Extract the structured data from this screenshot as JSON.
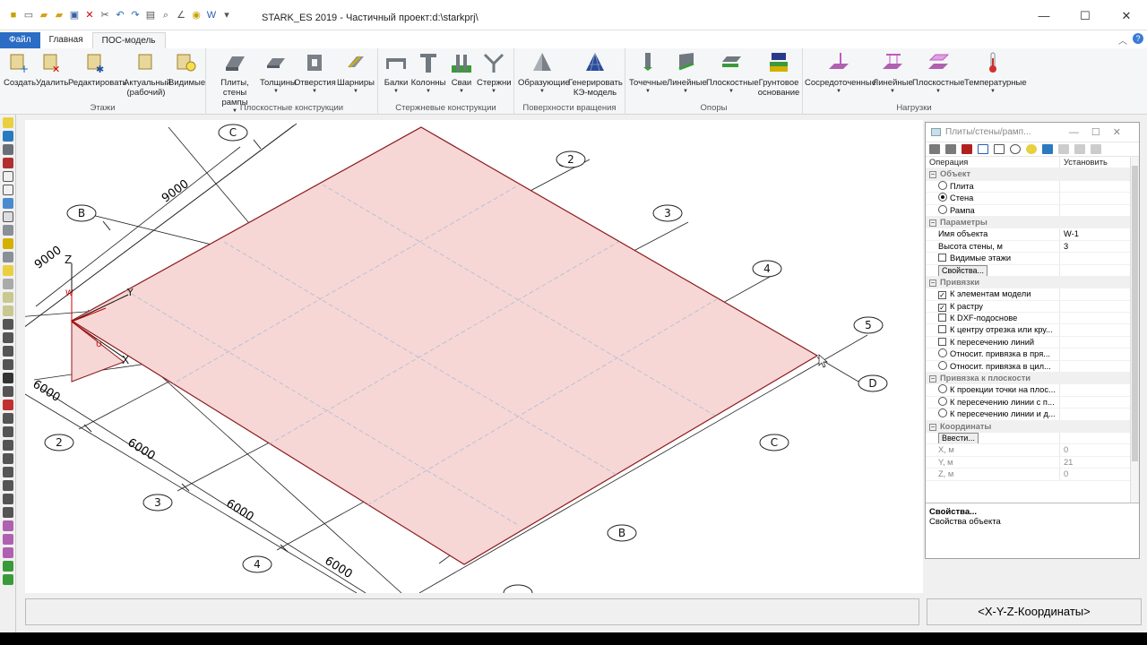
{
  "window": {
    "title": "STARK_ES 2019 - Частичный проект:d:\\starkprj\\",
    "minimize": "—",
    "maximize": "☐",
    "close": "✕"
  },
  "tabs": [
    {
      "label": "Файл"
    },
    {
      "label": "Главная"
    },
    {
      "label": "ПОС-модель"
    }
  ],
  "ribbon": {
    "groups": [
      {
        "name": "Этажи",
        "buttons": [
          "Создать",
          "Удалить",
          "Редактировать",
          "Актуальный (рабочий)",
          "Видимые"
        ]
      },
      {
        "name": "Плоскостные конструкции",
        "buttons": [
          "Плиты, стены рампы",
          "Толщины",
          "Отверстия",
          "Шарниры"
        ]
      },
      {
        "name": "Стержневые конструкции",
        "buttons": [
          "Балки",
          "Колонны",
          "Сваи",
          "Стержни"
        ]
      },
      {
        "name": "Поверхности вращения",
        "buttons": [
          "Образующие",
          "Генерировать КЭ-модель"
        ]
      },
      {
        "name": "Опоры",
        "buttons": [
          "Точечные",
          "Линейные",
          "Плоскостные",
          "Грунтовое основание"
        ]
      },
      {
        "name": "Нагрузки",
        "buttons": [
          "Сосредоточенные",
          "Линейные",
          "Плоскостные",
          "Температурные"
        ]
      }
    ]
  },
  "viewport": {
    "axis_labels": {
      "z": "Z",
      "y": "Y",
      "x": "X",
      "w": "W",
      "u": "U"
    },
    "grid_circles": [
      "C",
      "B",
      "2",
      "3",
      "4",
      "5",
      "D",
      "C",
      "B",
      "2",
      "3",
      "4"
    ],
    "dimensions": [
      "9000",
      "9000",
      "6000",
      "6000",
      "6000",
      "6000"
    ]
  },
  "panel": {
    "title": "Плиты/стены/рамп...",
    "header": {
      "col1": "Операция",
      "col2": "Установить"
    },
    "sections": {
      "object": "Объект",
      "params": "Параметры",
      "snaps": "Привязки",
      "plane_snap": "Привязка к плоскости",
      "coords": "Координаты"
    },
    "object_options": [
      {
        "label": "Плита",
        "selected": false
      },
      {
        "label": "Стена",
        "selected": true
      },
      {
        "label": "Рампа",
        "selected": false
      }
    ],
    "params": {
      "name_label": "Имя объекта",
      "name_value": "W-1",
      "height_label": "Высота стены, м",
      "height_value": "3",
      "visible_floors": "Видимые этажи",
      "props_button": "Свойства..."
    },
    "snaps": [
      {
        "label": "К элементам модели",
        "checked": true,
        "kind": "check"
      },
      {
        "label": "К растру",
        "checked": true,
        "kind": "check"
      },
      {
        "label": "К DXF-подоснове",
        "checked": false,
        "kind": "check"
      },
      {
        "label": "К центру отрезка или кру...",
        "checked": false,
        "kind": "check"
      },
      {
        "label": "К пересечению линий",
        "checked": false,
        "kind": "check"
      },
      {
        "label": "Относит. привязка в пря...",
        "checked": false,
        "kind": "radio"
      },
      {
        "label": "Относит. привязка в цил...",
        "checked": false,
        "kind": "radio"
      }
    ],
    "plane_snaps": [
      "К проекции точки на плос...",
      "К пересечению линии с п...",
      "К пересечению линии и д..."
    ],
    "coords": {
      "enter_button": "Ввести...",
      "x_label": "X, м",
      "x_value": "0",
      "y_label": "Y, м",
      "y_value": "21",
      "z_label": "Z, м",
      "z_value": "0"
    },
    "description_title": "Свойства...",
    "description_text": "Свойства объекта"
  },
  "status": {
    "coords_mode": "<X-Y-Z-Координаты>"
  },
  "colors": {
    "plate_fill": "#f7d6d6",
    "plate_edge": "#8b1a1a",
    "file_tab": "#2b6cc4"
  }
}
